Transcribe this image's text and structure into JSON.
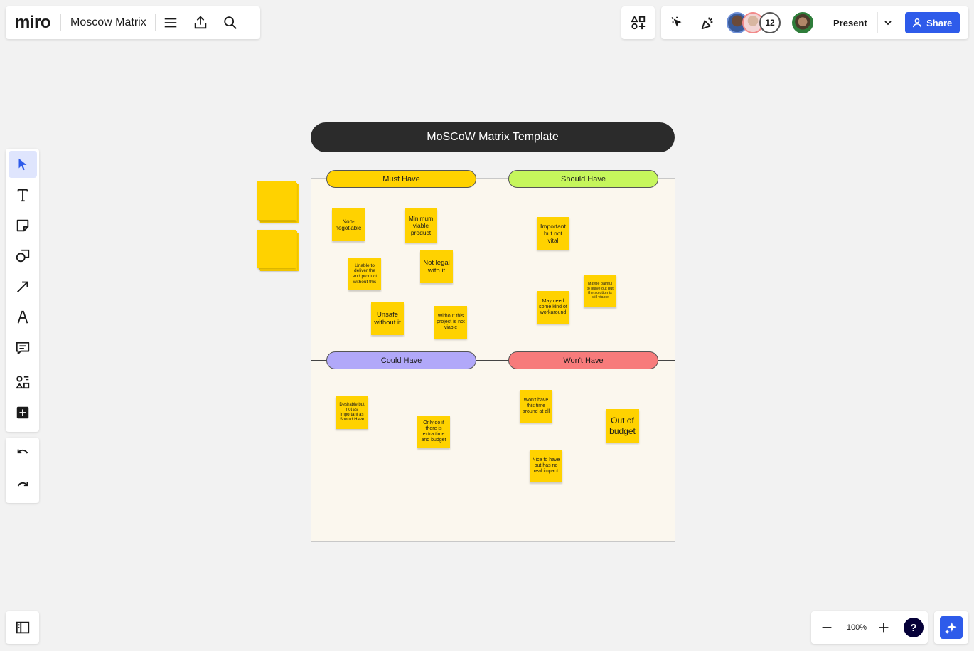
{
  "app": {
    "logo": "miro",
    "board_title": "Moscow Matrix"
  },
  "toolbar": {
    "present_label": "Present",
    "share_label": "Share",
    "collaborator_count": "12"
  },
  "zoom": {
    "level": "100%"
  },
  "help": {
    "label": "?"
  },
  "board": {
    "title": "MoSCoW Matrix Template",
    "quadrants": [
      {
        "label": "Must Have",
        "color": "#ffd200"
      },
      {
        "label": "Should Have",
        "color": "#c6f65c"
      },
      {
        "label": "Could Have",
        "color": "#b1a8f9"
      },
      {
        "label": "Won't Have",
        "color": "#f77b7b"
      }
    ],
    "stickies": {
      "must": [
        "Non-negotiable",
        "Minimum viable product",
        "Unable to deliver the end product without this",
        "Not legal with it",
        "Unsafe without it",
        "Without this project is not viable"
      ],
      "should": [
        "Important but not vital",
        "Maybe painful to leave out but the solution is still viable",
        "May need some kind of workaround"
      ],
      "could": [
        "Desirable but not as important as Should Have",
        "Only do if there is extra time and budget"
      ],
      "wont": [
        "Won't have this time around at all",
        "Out of budget",
        "Nice to have but has no real impact"
      ]
    }
  },
  "colors": {
    "accent": "#2e5bea",
    "sticky": "#ffd200",
    "board_background": "#fbf7ee",
    "title_bar": "#2b2b2b"
  }
}
